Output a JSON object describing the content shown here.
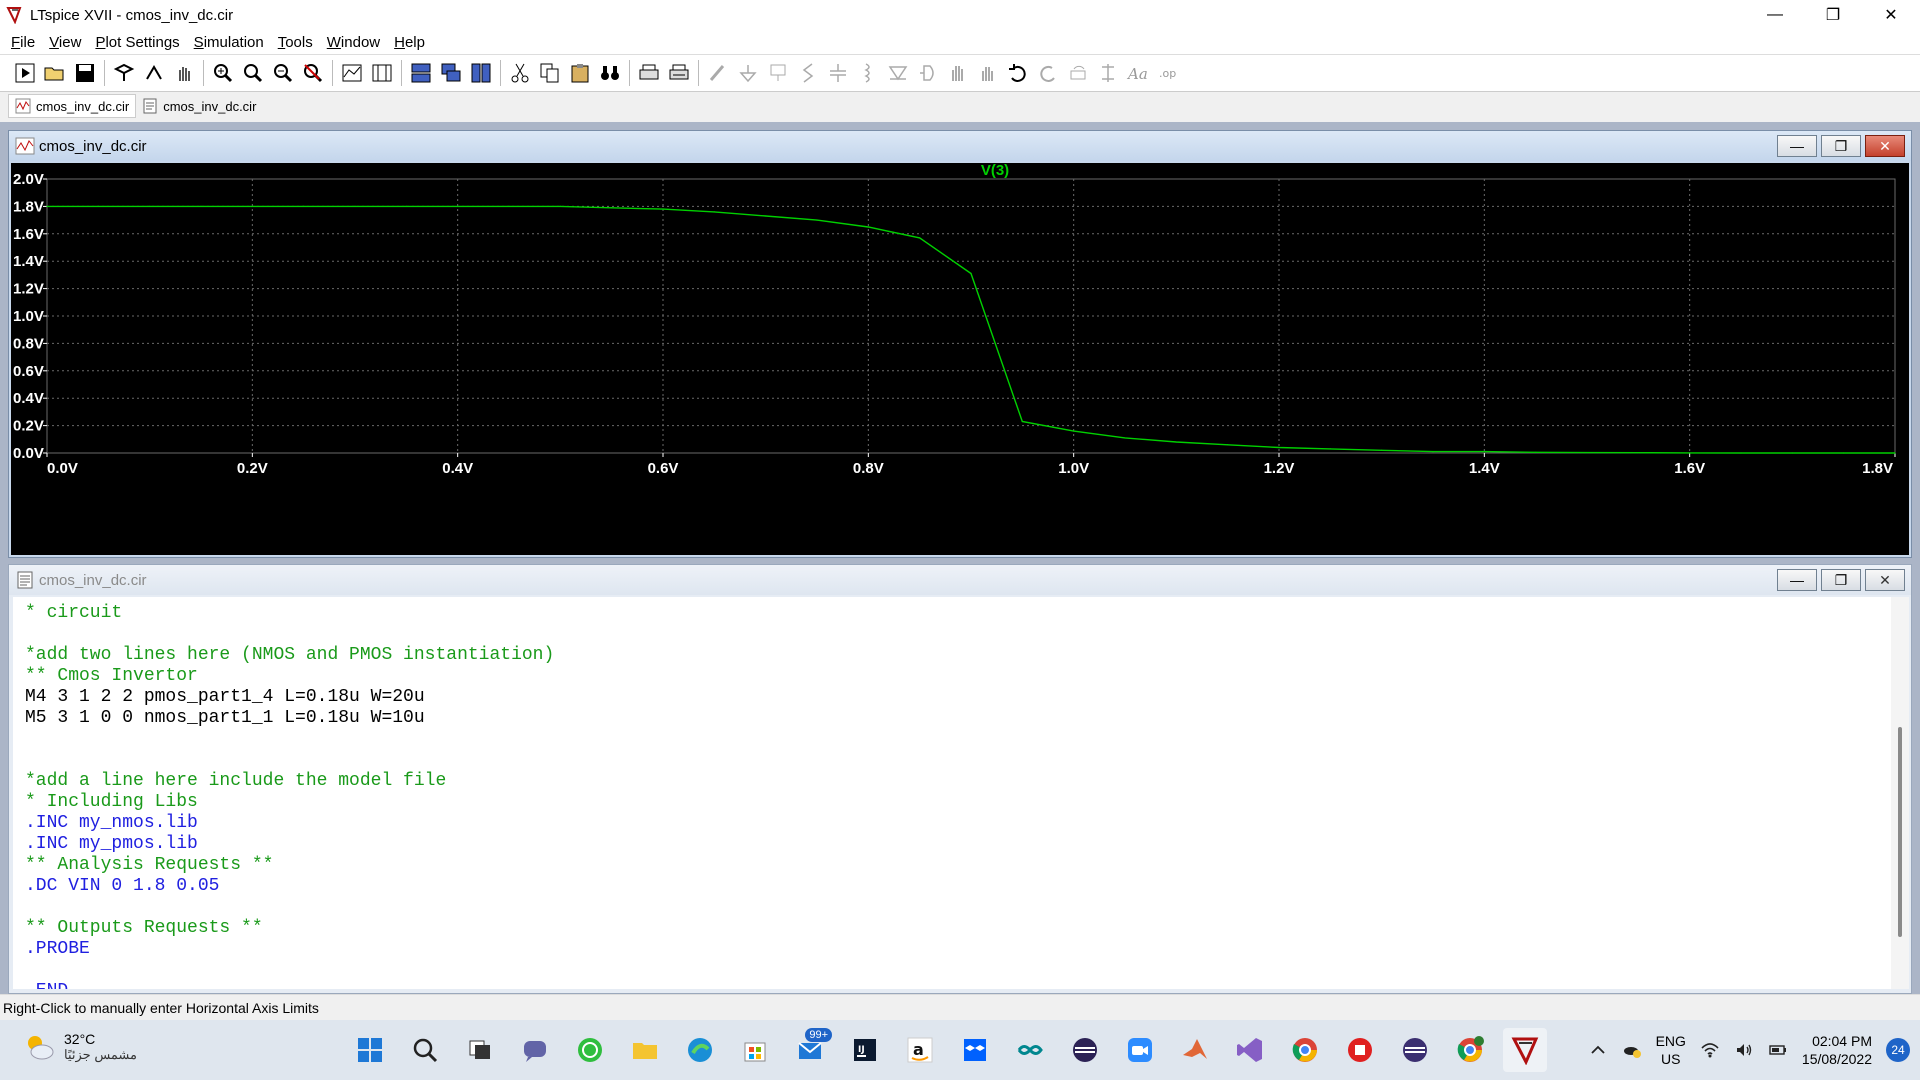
{
  "window": {
    "title": "LTspice XVII - cmos_inv_dc.cir",
    "minimize": "—",
    "maximize": "❐",
    "close": "✕"
  },
  "menu": {
    "items": [
      {
        "label": "File",
        "key": "F"
      },
      {
        "label": "View",
        "key": "V"
      },
      {
        "label": "Plot Settings",
        "key": "P"
      },
      {
        "label": "Simulation",
        "key": "S"
      },
      {
        "label": "Tools",
        "key": "T"
      },
      {
        "label": "Window",
        "key": "W"
      },
      {
        "label": "Help",
        "key": "H"
      }
    ]
  },
  "tabs": [
    {
      "label": "cmos_inv_dc.cir",
      "icon": "waveform-icon",
      "active": true
    },
    {
      "label": "cmos_inv_dc.cir",
      "icon": "netlist-icon",
      "active": false
    }
  ],
  "plot_window": {
    "title": "cmos_inv_dc.cir"
  },
  "netlist_window": {
    "title": "cmos_inv_dc.cir",
    "lines": [
      {
        "text": "* circuit",
        "color": "green"
      },
      {
        "text": "",
        "color": "black"
      },
      {
        "text": "*add two lines here (NMOS and PMOS instantiation)",
        "color": "green"
      },
      {
        "text": "** Cmos Invertor",
        "color": "green"
      },
      {
        "text": "M4 3 1 2 2 pmos_part1_4 L=0.18u W=20u",
        "color": "black"
      },
      {
        "text": "M5 3 1 0 0 nmos_part1_1 L=0.18u W=10u",
        "color": "black"
      },
      {
        "text": "",
        "color": "black"
      },
      {
        "text": "",
        "color": "black"
      },
      {
        "text": "*add a line here include the model file",
        "color": "green"
      },
      {
        "text": "* Including Libs",
        "color": "green"
      },
      {
        "text": ".INC my_nmos.lib",
        "color": "blue"
      },
      {
        "text": ".INC my_pmos.lib",
        "color": "blue"
      },
      {
        "text": "** Analysis Requests **",
        "color": "green"
      },
      {
        "text": ".DC VIN 0 1.8 0.05",
        "color": "blue"
      },
      {
        "text": "",
        "color": "black"
      },
      {
        "text": "** Outputs Requests **",
        "color": "green"
      },
      {
        "text": ".PROBE",
        "color": "blue"
      },
      {
        "text": "",
        "color": "black"
      },
      {
        "text": ".END",
        "color": "blue"
      }
    ]
  },
  "chart_data": {
    "type": "line",
    "title": "V(3)",
    "xlim": [
      0,
      1.8
    ],
    "ylim": [
      0,
      2.0
    ],
    "x_ticks": [
      "0.0V",
      "0.2V",
      "0.4V",
      "0.6V",
      "0.8V",
      "1.0V",
      "1.2V",
      "1.4V",
      "1.6V",
      "1.8V"
    ],
    "y_ticks": [
      "2.0V",
      "1.8V",
      "1.6V",
      "1.4V",
      "1.2V",
      "1.0V",
      "0.8V",
      "0.6V",
      "0.4V",
      "0.2V",
      "0.0V"
    ],
    "grid": true,
    "colors": {
      "background": "#000000",
      "trace": "#00d000",
      "axis_text": "#ffffff",
      "grid": "#6a6a6a",
      "title": "#00d000"
    },
    "series": [
      {
        "name": "V(3)",
        "x": [
          0.0,
          0.05,
          0.1,
          0.15,
          0.2,
          0.25,
          0.3,
          0.35,
          0.4,
          0.45,
          0.5,
          0.55,
          0.6,
          0.65,
          0.7,
          0.75,
          0.8,
          0.85,
          0.9,
          0.95,
          1.0,
          1.05,
          1.1,
          1.15,
          1.2,
          1.25,
          1.3,
          1.35,
          1.4,
          1.45,
          1.5,
          1.55,
          1.6,
          1.65,
          1.7,
          1.75,
          1.8
        ],
        "y": [
          1.8,
          1.8,
          1.8,
          1.8,
          1.8,
          1.8,
          1.8,
          1.8,
          1.8,
          1.8,
          1.8,
          1.79,
          1.78,
          1.76,
          1.73,
          1.7,
          1.65,
          1.57,
          1.31,
          0.23,
          0.16,
          0.11,
          0.08,
          0.06,
          0.04,
          0.03,
          0.02,
          0.01,
          0.01,
          0.005,
          0.003,
          0.002,
          0.001,
          0.0,
          0.0,
          0.0,
          0.0
        ]
      }
    ]
  },
  "statusbar": {
    "text": "Right-Click to manually enter Horizontal Axis Limits"
  },
  "taskbar": {
    "weather_temp": "32°C",
    "weather_desc": "مشمس جزئيًا",
    "mail_badge": "99+",
    "lang_top": "ENG",
    "lang_bottom": "US",
    "time": "02:04 PM",
    "date": "15/08/2022",
    "notif_count": "24"
  }
}
